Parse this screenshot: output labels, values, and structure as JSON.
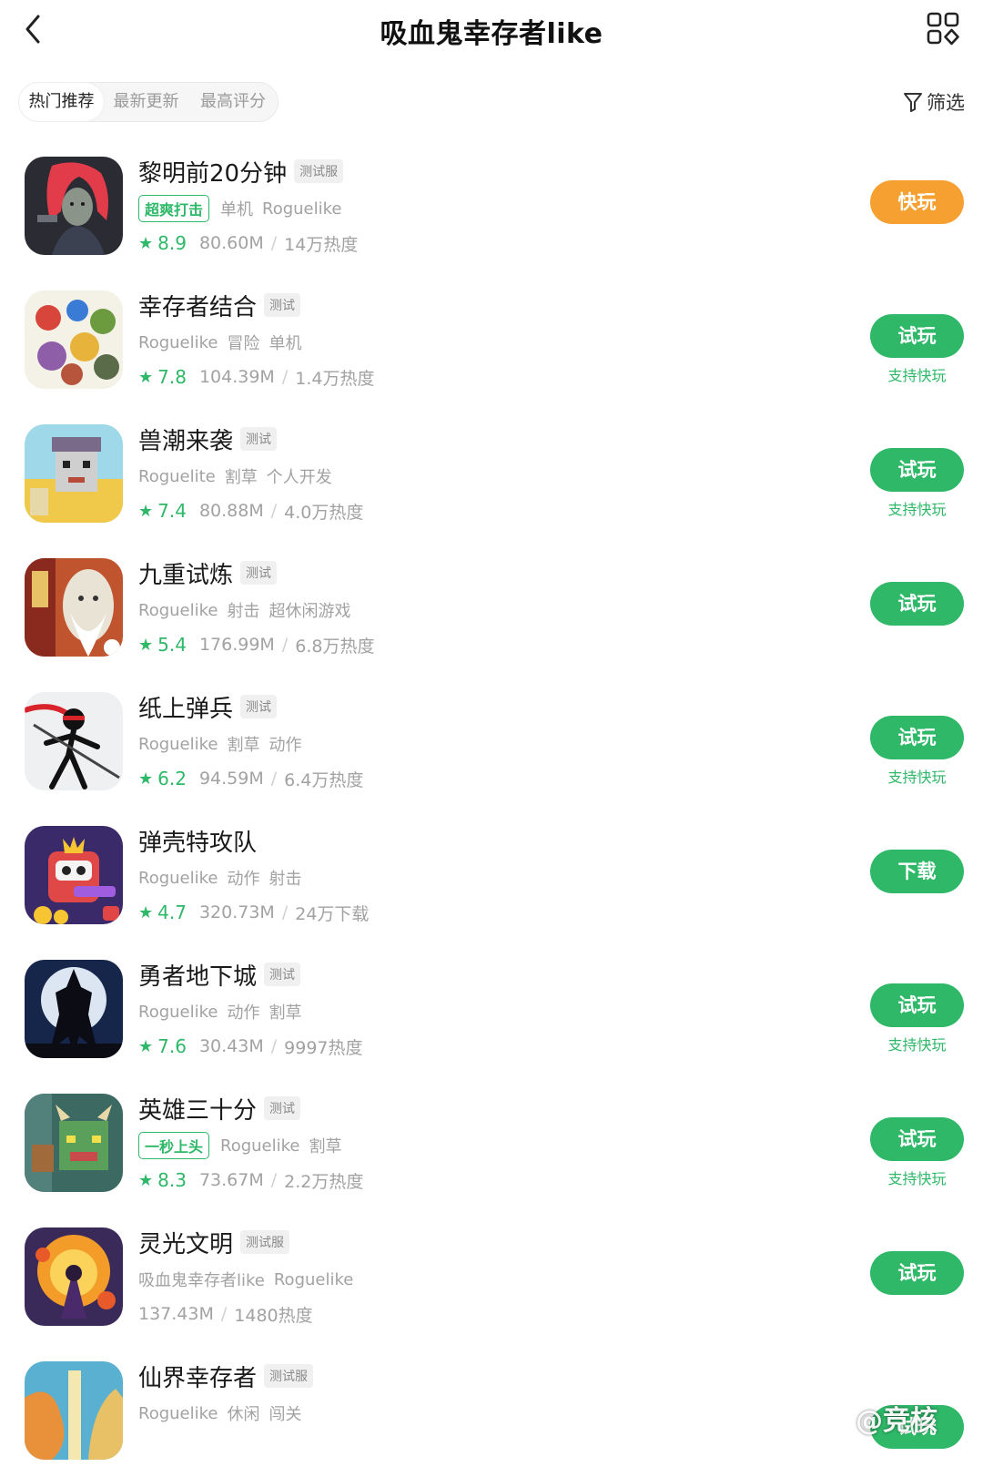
{
  "header": {
    "title": "吸血鬼幸存者like"
  },
  "icons": {
    "back": "chevron-left-icon",
    "grid": "grid-apps-icon",
    "filter": "funnel-icon",
    "star": "star-icon"
  },
  "colors": {
    "accent": "#2eb868",
    "orange": "#f5a030",
    "muted": "#a2a2a2"
  },
  "tabs": [
    {
      "label": "热门推荐",
      "active": true
    },
    {
      "label": "最新更新",
      "active": false
    },
    {
      "label": "最高评分",
      "active": false
    }
  ],
  "filter": {
    "label": "筛选"
  },
  "star_glyph": "★",
  "games": [
    {
      "name": "黎明前20分钟",
      "badge": "测试服",
      "highlight": "超爽打击",
      "tags": [
        "单机",
        "Roguelike"
      ],
      "rating": "8.9",
      "size": "80.60M",
      "stat": "14万热度",
      "button": "快玩",
      "sub": ""
    },
    {
      "name": "幸存者结合",
      "badge": "测试",
      "highlight": "",
      "tags": [
        "Roguelike",
        "冒险",
        "单机"
      ],
      "rating": "7.8",
      "size": "104.39M",
      "stat": "1.4万热度",
      "button": "试玩",
      "sub": "支持快玩"
    },
    {
      "name": "兽潮来袭",
      "badge": "测试",
      "highlight": "",
      "tags": [
        "Roguelite",
        "割草",
        "个人开发"
      ],
      "rating": "7.4",
      "size": "80.88M",
      "stat": "4.0万热度",
      "button": "试玩",
      "sub": "支持快玩"
    },
    {
      "name": "九重试炼",
      "badge": "测试",
      "highlight": "",
      "tags": [
        "Roguelike",
        "射击",
        "超休闲游戏"
      ],
      "rating": "5.4",
      "size": "176.99M",
      "stat": "6.8万热度",
      "button": "试玩",
      "sub": ""
    },
    {
      "name": "纸上弹兵",
      "badge": "测试",
      "highlight": "",
      "tags": [
        "Roguelike",
        "割草",
        "动作"
      ],
      "rating": "6.2",
      "size": "94.59M",
      "stat": "6.4万热度",
      "button": "试玩",
      "sub": "支持快玩"
    },
    {
      "name": "弹壳特攻队",
      "badge": "",
      "highlight": "",
      "tags": [
        "Roguelike",
        "动作",
        "射击"
      ],
      "rating": "4.7",
      "size": "320.73M",
      "stat": "24万下载",
      "button": "下载",
      "sub": ""
    },
    {
      "name": "勇者地下城",
      "badge": "测试",
      "highlight": "",
      "tags": [
        "Roguelike",
        "动作",
        "割草"
      ],
      "rating": "7.6",
      "size": "30.43M",
      "stat": "9997热度",
      "button": "试玩",
      "sub": "支持快玩"
    },
    {
      "name": "英雄三十分",
      "badge": "测试",
      "highlight": "一秒上头",
      "tags": [
        "Roguelike",
        "割草"
      ],
      "rating": "8.3",
      "size": "73.67M",
      "stat": "2.2万热度",
      "button": "试玩",
      "sub": "支持快玩"
    },
    {
      "name": "灵光文明",
      "badge": "测试服",
      "highlight": "",
      "tags": [
        "吸血鬼幸存者like",
        "Roguelike"
      ],
      "rating": "",
      "size": "137.43M",
      "stat": "1480热度",
      "button": "试玩",
      "sub": ""
    },
    {
      "name": "仙界幸存者",
      "badge": "测试服",
      "highlight": "",
      "tags": [
        "Roguelike",
        "休闲",
        "闯关"
      ],
      "rating": "",
      "size": "",
      "stat": "",
      "button": "试玩",
      "sub": ""
    }
  ],
  "watermark": "@竞核"
}
